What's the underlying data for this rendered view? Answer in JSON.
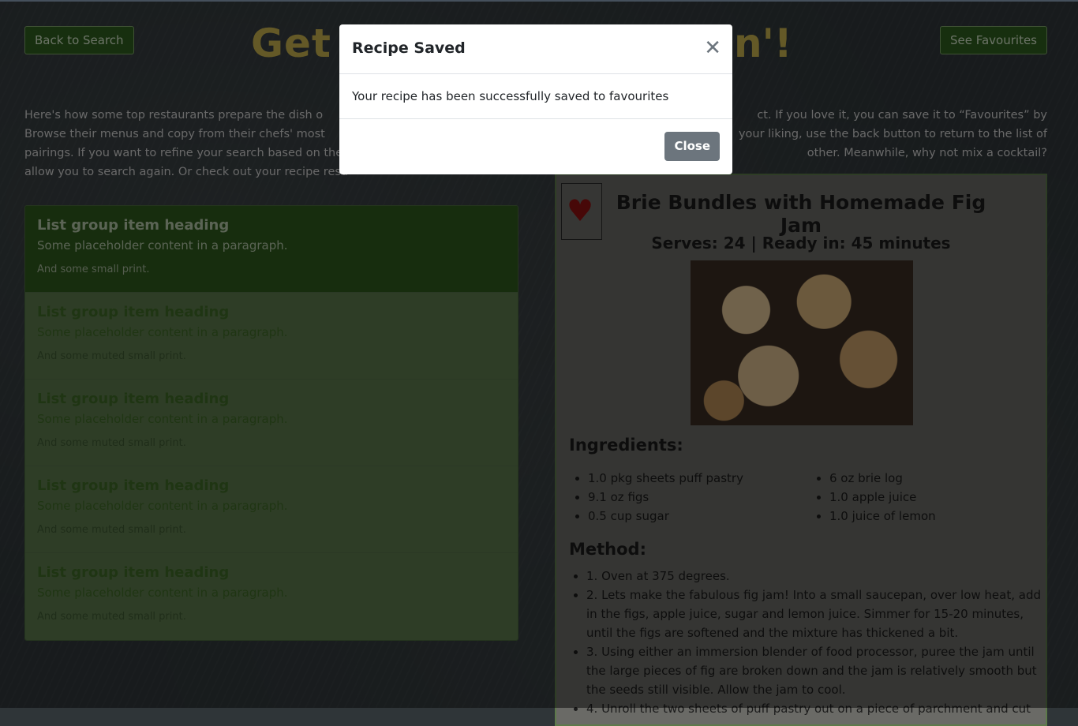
{
  "nav": {
    "back_label": "Back to Search",
    "fav_label": "See Favourites"
  },
  "header": {
    "title_visible_start": "Get I",
    "title_visible_end": "n'!"
  },
  "intro": {
    "lines": [
      {
        "left": "Here's how some top restaurants prepare the dish o",
        "right": "ct. If you love it, you can save it to “Favourites” by"
      },
      {
        "left": "Browse their menus and copy from their chefs' most",
        "right": "your liking, use the back button to return to the list of"
      },
      {
        "left": "pairings. If you want to refine your search based on the",
        "right": "other. Meanwhile, why not mix a cocktail?"
      },
      {
        "left": "allow you to search again. Or check out your recipe resu",
        "right": ""
      }
    ]
  },
  "list": {
    "items": [
      {
        "heading": "List group item heading",
        "text": "Some placeholder content in a paragraph.",
        "small": "And some small print."
      },
      {
        "heading": "List group item heading",
        "text": "Some placeholder content in a paragraph.",
        "small": "And some muted small print."
      },
      {
        "heading": "List group item heading",
        "text": "Some placeholder content in a paragraph.",
        "small": "And some muted small print."
      },
      {
        "heading": "List group item heading",
        "text": "Some placeholder content in a paragraph.",
        "small": "And some muted small print."
      },
      {
        "heading": "List group item heading",
        "text": "Some placeholder content in a paragraph.",
        "small": "And some muted small print."
      }
    ]
  },
  "recipe": {
    "title": "Brie Bundles with Homemade Fig Jam",
    "meta": "Serves: 24 | Ready in: 45 minutes",
    "ingredients_heading": "Ingredients:",
    "ingredients_col1": [
      "1.0 pkg sheets puff pastry",
      "9.1 oz figs",
      "0.5 cup sugar"
    ],
    "ingredients_col2": [
      "6 oz brie log",
      "1.0 apple juice",
      "1.0 juice of lemon"
    ],
    "method_heading": "Method:",
    "method": [
      "1. Oven at 375 degrees.",
      "2. Lets make the fabulous fig jam! Into a small saucepan, over low heat, add in the figs, apple juice, sugar and lemon juice. Simmer for 15-20 minutes, until the figs are softened and the mixture has thickened a bit.",
      "3. Using either an immersion blender of food processor, puree the jam until the large pieces of fig are broken down and the jam is relatively smooth but the seeds still visible. Allow the jam to cool.",
      "4. Unroll the two sheets of puff pastry out on a piece of parchment and cut"
    ],
    "favourite_icon": "heart-icon"
  },
  "modal": {
    "title": "Recipe Saved",
    "close_icon": "close-icon",
    "body": "Your recipe has been successfully saved to favourites",
    "close_label": "Close"
  },
  "colors": {
    "accent_green": "#2f5f1f",
    "title_gold": "#c8b24e",
    "modal_button": "#6c757d"
  }
}
